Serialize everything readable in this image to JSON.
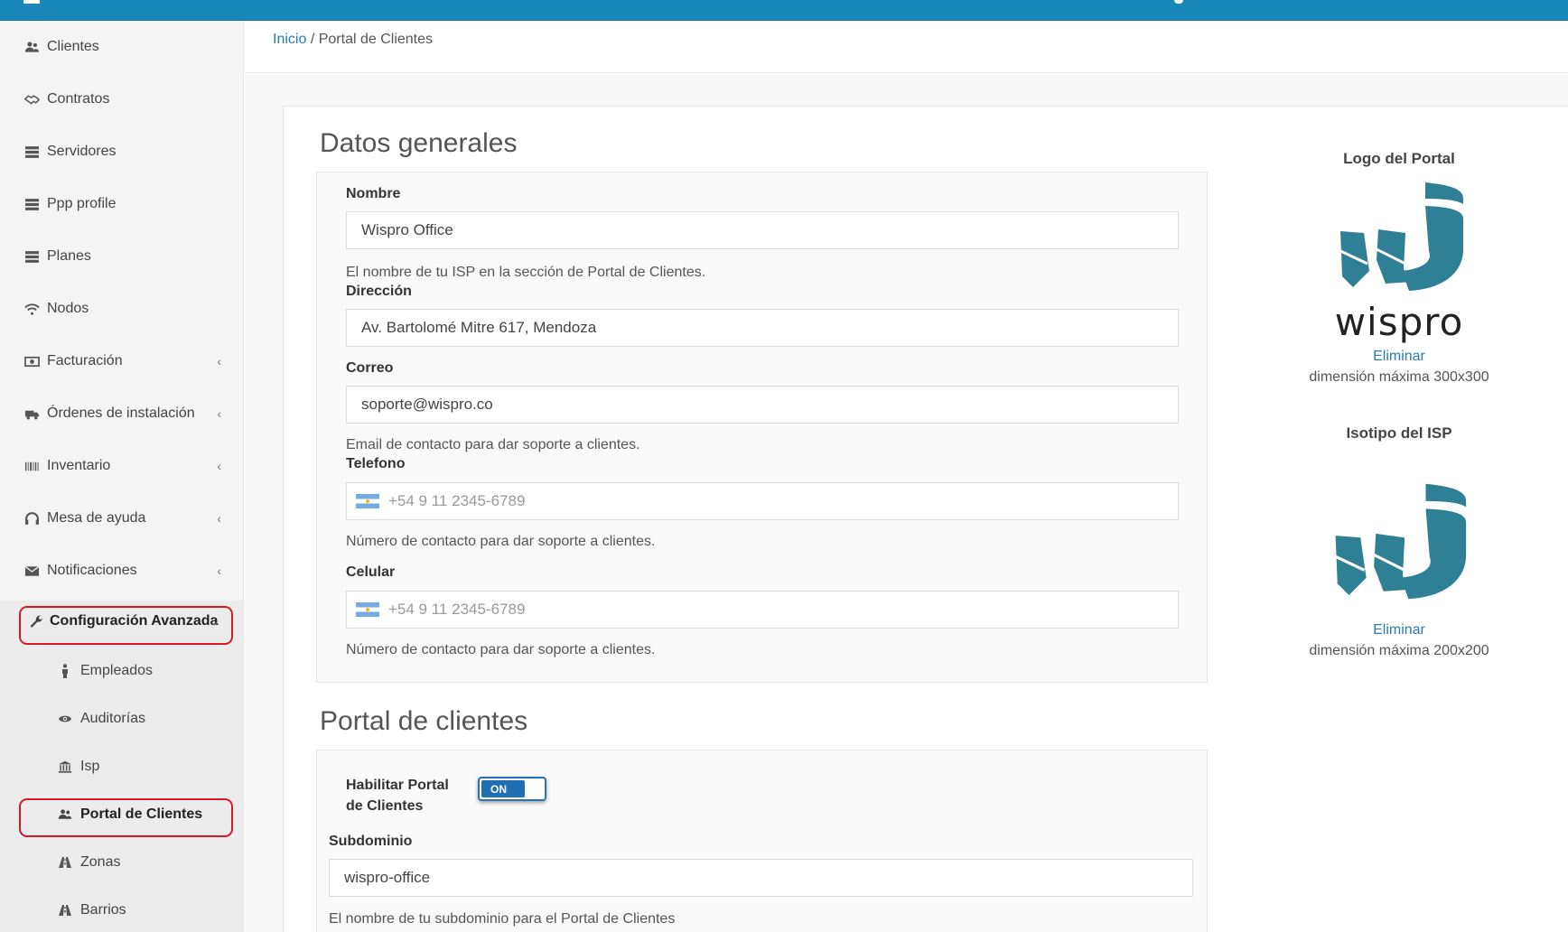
{
  "colors": {
    "topbar": "#1a87b9",
    "link": "#2a7ab5",
    "highlight": "#d9192a",
    "toggle": "#1f6fb2",
    "logo": "#2f7f95"
  },
  "sidebar": {
    "items": [
      {
        "label": "Clientes",
        "icon": "users-icon"
      },
      {
        "label": "Contratos",
        "icon": "handshake-icon"
      },
      {
        "label": "Servidores",
        "icon": "server-icon"
      },
      {
        "label": "Ppp profile",
        "icon": "server-icon"
      },
      {
        "label": "Planes",
        "icon": "server-icon"
      },
      {
        "label": "Nodos",
        "icon": "wifi-icon"
      },
      {
        "label": "Facturación",
        "icon": "money-icon"
      },
      {
        "label": "Órdenes de instalación",
        "icon": "truck-icon"
      },
      {
        "label": "Inventario",
        "icon": "barcode-icon"
      },
      {
        "label": "Mesa de ayuda",
        "icon": "headset-icon"
      },
      {
        "label": "Notificaciones",
        "icon": "envelope-icon"
      },
      {
        "label": "Configuración Avanzada",
        "icon": "wrench-icon"
      }
    ],
    "submenu": [
      {
        "label": "Empleados",
        "icon": "person-icon"
      },
      {
        "label": "Auditorías",
        "icon": "eye-icon"
      },
      {
        "label": "Isp",
        "icon": "bank-icon"
      },
      {
        "label": "Portal de Clientes",
        "icon": "users-icon"
      },
      {
        "label": "Zonas",
        "icon": "road-icon"
      },
      {
        "label": "Barrios",
        "icon": "road-icon"
      }
    ]
  },
  "breadcrumb": {
    "home": "Inicio",
    "separator": "/",
    "current": "Portal de Clientes"
  },
  "general": {
    "title": "Datos generales",
    "nombre_label": "Nombre",
    "nombre_value": "Wispro Office",
    "nombre_help": "El nombre de tu ISP en la sección de Portal de Clientes.",
    "direccion_label": "Dirección",
    "direccion_value": "Av. Bartolomé Mitre 617, Mendoza",
    "correo_label": "Correo",
    "correo_value": "soporte@wispro.co",
    "correo_help": "Email de contacto para dar soporte a clientes.",
    "telefono_label": "Telefono",
    "telefono_placeholder": "+54 9 11 2345-6789",
    "telefono_help": "Número de contacto para dar soporte a clientes.",
    "celular_label": "Celular",
    "celular_placeholder": "+54 9 11 2345-6789",
    "celular_help": "Número de contacto para dar soporte a clientes."
  },
  "portal": {
    "title": "Portal de clientes",
    "habilitar_label_1": "Habilitar Portal",
    "habilitar_label_2": "de Clientes",
    "toggle_on": "ON",
    "subdominio_label": "Subdominio",
    "subdominio_value": "wispro-office",
    "subdominio_help": "El nombre de tu subdominio para el Portal de Clientes"
  },
  "logos": {
    "portal_title": "Logo del Portal",
    "portal_wordmark": "wispro",
    "portal_remove": "Eliminar",
    "portal_note": "dimensión máxima 300x300",
    "isp_title": "Isotipo del ISP",
    "isp_remove": "Eliminar",
    "isp_note": "dimensión máxima 200x200"
  }
}
